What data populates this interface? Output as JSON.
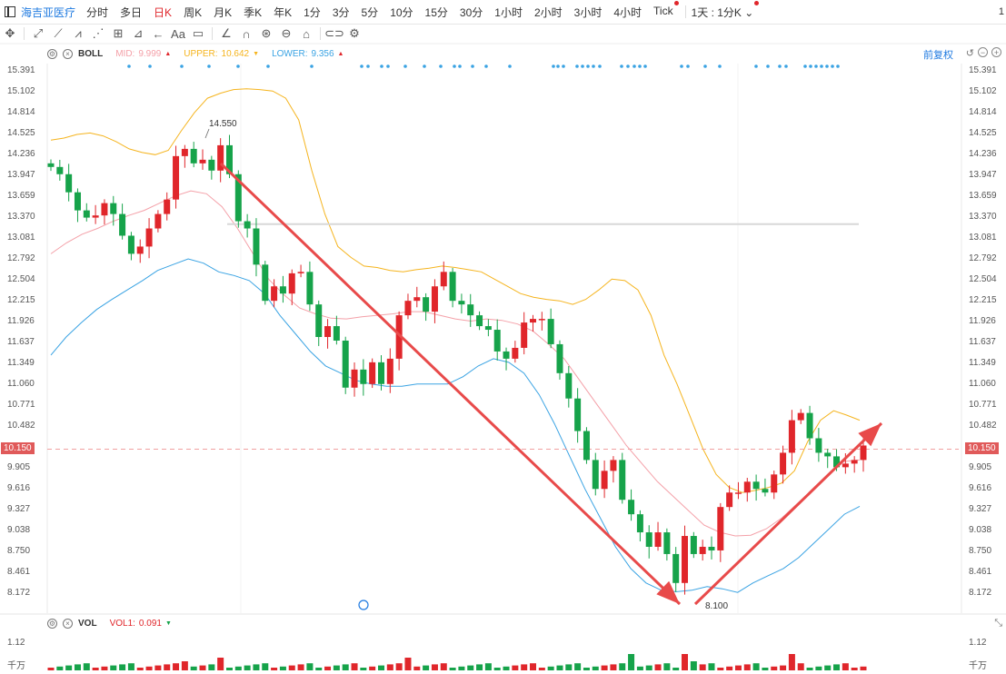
{
  "topbar": {
    "stock_name": "海吉亚医疗",
    "periods": [
      "分时",
      "多日",
      "日K",
      "周K",
      "月K",
      "季K",
      "年K",
      "1分",
      "3分",
      "5分",
      "10分",
      "15分",
      "30分",
      "1小时",
      "2小时",
      "3小时",
      "4小时",
      "Tick"
    ],
    "active_period": "日K",
    "timeframe": "1天 : 1分K",
    "more": "1"
  },
  "indicator": {
    "name": "BOLL",
    "mid_label": "MID:",
    "mid_value": "9.999",
    "upper_label": "UPPER:",
    "upper_value": "10.642",
    "lower_label": "LOWER:",
    "lower_value": "9.356",
    "adjust_label": "前复权"
  },
  "volume_panel": {
    "name": "VOL",
    "vol1_label": "VOL1:",
    "vol1_value": "0.091",
    "axis_top": "1.12",
    "axis_unit": "千万"
  },
  "colors": {
    "up": "#e0262b",
    "down": "#16a34a",
    "upper_band": "#f5b41e",
    "mid_band": "#f4a0a8",
    "lower_band": "#3aa3e3",
    "trend_arrow": "#e84a4a",
    "current_price": "#e05a5a"
  },
  "chart_data": {
    "type": "candlestick",
    "price_axis_ticks": [
      "15.391",
      "15.102",
      "14.814",
      "14.525",
      "14.236",
      "13.947",
      "13.659",
      "13.370",
      "13.081",
      "12.792",
      "12.504",
      "12.215",
      "11.926",
      "11.637",
      "11.349",
      "11.060",
      "10.771",
      "10.482",
      "10.150",
      "9.905",
      "9.616",
      "9.327",
      "9.038",
      "8.750",
      "8.461",
      "8.172"
    ],
    "ylim": [
      8.0,
      15.45
    ],
    "current_price": "10.150",
    "annotations": {
      "high": "14.550",
      "low": "8.100"
    },
    "resistance_line": 13.26,
    "closes": [
      14.05,
      13.95,
      13.7,
      13.45,
      13.35,
      13.38,
      13.55,
      13.4,
      13.1,
      12.85,
      12.95,
      13.2,
      13.4,
      13.6,
      14.2,
      14.3,
      14.1,
      14.15,
      14.0,
      14.35,
      13.95,
      13.3,
      13.2,
      12.7,
      12.2,
      12.4,
      12.3,
      12.58,
      12.6,
      12.15,
      11.7,
      11.85,
      11.65,
      11.0,
      11.25,
      11.05,
      11.35,
      11.05,
      11.4,
      12.0,
      12.2,
      12.25,
      12.05,
      12.4,
      12.6,
      12.2,
      12.15,
      12.0,
      11.85,
      11.8,
      11.5,
      11.4,
      11.55,
      11.9,
      11.95,
      11.95,
      11.6,
      11.2,
      10.85,
      10.4,
      10.0,
      9.6,
      9.85,
      10.0,
      9.45,
      9.25,
      9.0,
      8.8,
      9.0,
      8.7,
      8.3,
      8.95,
      8.7,
      8.8,
      8.75,
      9.35,
      9.55,
      9.55,
      9.7,
      9.6,
      9.55,
      9.8,
      10.1,
      10.55,
      10.65,
      10.3,
      10.1,
      10.05,
      9.9,
      9.95,
      10.0,
      10.2
    ],
    "upper_band": [
      14.42,
      14.45,
      14.5,
      14.52,
      14.48,
      14.4,
      14.3,
      14.25,
      14.22,
      14.28,
      14.55,
      14.8,
      15.0,
      15.07,
      15.12,
      15.13,
      15.12,
      15.1,
      15.0,
      14.7,
      14.0,
      13.4,
      12.95,
      12.8,
      12.68,
      12.66,
      12.62,
      12.6,
      12.63,
      12.65,
      12.68,
      12.66,
      12.63,
      12.6,
      12.5,
      12.4,
      12.3,
      12.25,
      12.22,
      12.2,
      12.15,
      12.22,
      12.35,
      12.5,
      12.48,
      12.35,
      12.0,
      11.45,
      11.05,
      10.6,
      10.15,
      9.8,
      9.62,
      9.55,
      9.58,
      9.62,
      9.68,
      9.85,
      10.25,
      10.55,
      10.68,
      10.62,
      10.55
    ],
    "mid_band": [
      12.85,
      13.0,
      13.12,
      13.2,
      13.3,
      13.38,
      13.45,
      13.55,
      13.65,
      13.72,
      13.68,
      13.5,
      13.2,
      12.85,
      12.5,
      12.28,
      12.1,
      12.02,
      11.96,
      11.95,
      11.98,
      12.0,
      12.02,
      12.05,
      12.05,
      12.0,
      11.95,
      11.92,
      11.95,
      11.93,
      11.88,
      11.78,
      11.6,
      11.4,
      11.1,
      10.8,
      10.5,
      10.2,
      9.95,
      9.7,
      9.5,
      9.3,
      9.1,
      9.0,
      8.95,
      8.96,
      9.05,
      9.2,
      9.4,
      9.6,
      9.8,
      9.98,
      10.0
    ],
    "lower_band": [
      11.45,
      11.7,
      11.9,
      12.08,
      12.22,
      12.35,
      12.48,
      12.62,
      12.7,
      12.78,
      12.72,
      12.6,
      12.55,
      12.48,
      12.3,
      12.0,
      11.75,
      11.5,
      11.3,
      11.2,
      11.1,
      11.05,
      11.02,
      11.02,
      11.05,
      11.05,
      11.05,
      11.15,
      11.3,
      11.4,
      11.35,
      11.2,
      10.9,
      10.5,
      10.05,
      9.6,
      9.2,
      8.8,
      8.5,
      8.3,
      8.2,
      8.18,
      8.2,
      8.25,
      8.22,
      8.17,
      8.3,
      8.4,
      8.5,
      8.65,
      8.85,
      9.05,
      9.25,
      9.36
    ],
    "volume_scale_max": 1.12
  }
}
